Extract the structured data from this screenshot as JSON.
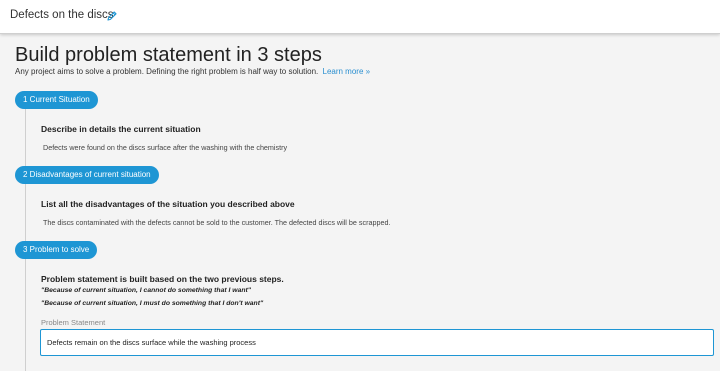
{
  "header": {
    "project_name": "Defects on the discs",
    "edit_icon": "pencil-icon"
  },
  "page": {
    "title": "Build problem statement in 3 steps",
    "subtitle": "Any project aims to solve a problem. Defining the right problem is half way to solution.",
    "learn_more": "Learn more »"
  },
  "steps": [
    {
      "label": "1 Current Situation",
      "question": "Describe in details the current situation",
      "answer": "Defects were found on the discs surface after the washing with the chemistry"
    },
    {
      "label": "2 Disadvantages of current situation",
      "question": "List all the disadvantages of the situation you described above",
      "answer": "The discs contaminated with the defects cannot be sold to the customer. The defected discs will be scrapped."
    },
    {
      "label": "3 Problem to solve",
      "question": "Problem statement is built based on the two previous steps.",
      "hints": [
        "\"Because of current situation, I cannot do something that I want\"",
        "\"Because of current situation, I must do something that I don't want\""
      ],
      "field_label": "Problem Statement",
      "field_value": "Defects remain on the discs surface while the washing process"
    }
  ],
  "colors": {
    "accent": "#1e96d4",
    "link": "#2a8fd0",
    "background": "#f4f4f4"
  }
}
